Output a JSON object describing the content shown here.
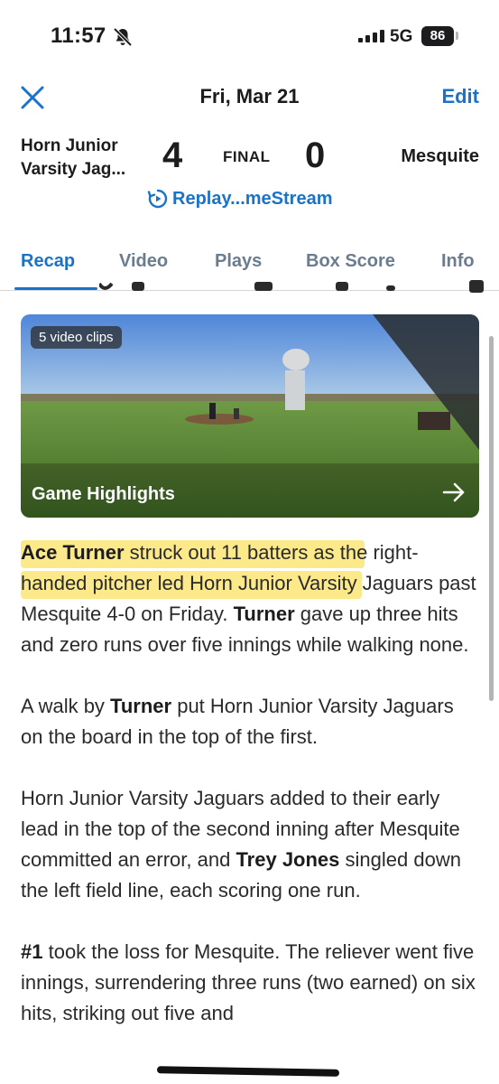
{
  "status_bar": {
    "time": "11:57",
    "network": "5G",
    "battery": "86"
  },
  "header": {
    "date": "Fri, Mar 21",
    "edit_label": "Edit"
  },
  "game": {
    "home_team": "Horn Junior Varsity Jag...",
    "home_score": "4",
    "status": "FINAL",
    "away_score": "0",
    "away_team": "Mesquite",
    "replay_label": "Replay...meStream"
  },
  "tabs": [
    {
      "label": "Recap",
      "active": true
    },
    {
      "label": "Video",
      "active": false
    },
    {
      "label": "Plays",
      "active": false
    },
    {
      "label": "Box Score",
      "active": false
    },
    {
      "label": "Info",
      "active": false
    }
  ],
  "video": {
    "clips_badge": "5 video clips",
    "title": "Game Highlights"
  },
  "article": {
    "p1": {
      "b1": "Ace Turner",
      "t1": " struck out 11 batters as the right-handed pitcher led Horn Junior Varsity Jaguars past Mesquite 4-0 on Friday. ",
      "b2": "Turner",
      "t2": " gave up three hits and zero runs over five innings while walking none."
    },
    "p2": {
      "t1": "A walk by ",
      "b1": "Turner",
      "t2": " put Horn Junior Varsity Jaguars on the board in the top of the first."
    },
    "p3": {
      "t1": "Horn Junior Varsity Jaguars added to their early lead in the top of the second inning after Mesquite committed an error, and ",
      "b1": "Trey Jones",
      "t2": " singled down the left field line, each scoring one run."
    },
    "p4": {
      "b1": "#1",
      "t1": " took the loss for Mesquite. The reliever went five innings, surrendering three runs (two earned) on six hits, striking out five and"
    }
  },
  "colors": {
    "accent": "#1a73c8",
    "highlight": "#fce98a"
  }
}
